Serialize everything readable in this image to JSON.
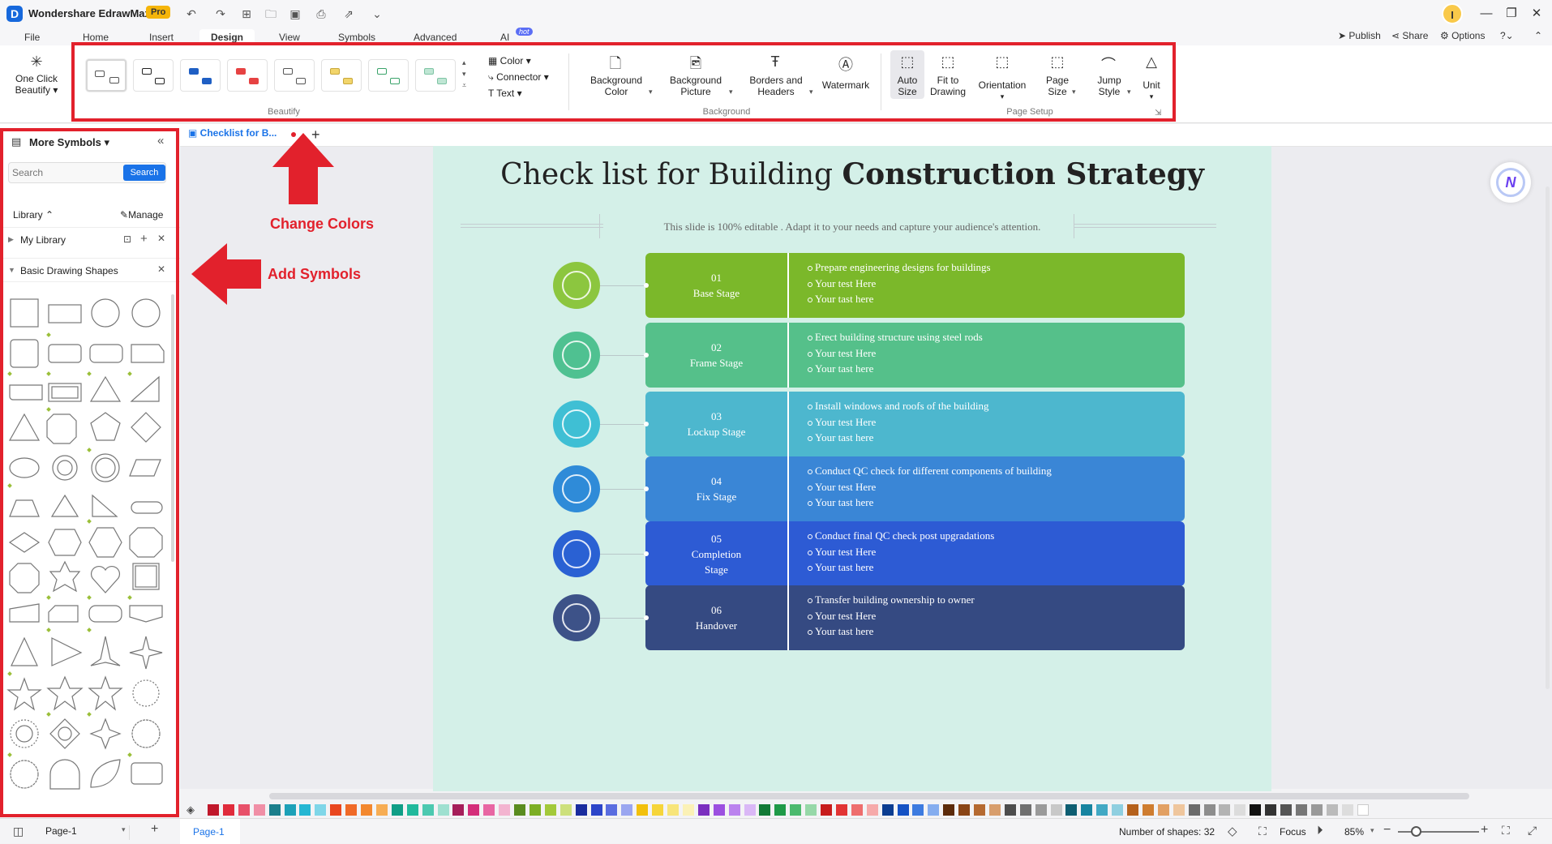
{
  "app": {
    "name": "Wondershare EdrawMax",
    "badge": "Pro",
    "user_initial": "I"
  },
  "menu": {
    "tabs": [
      "File",
      "Home",
      "Insert",
      "Design",
      "View",
      "Symbols",
      "Advanced",
      "AI"
    ],
    "active": "Design",
    "ai_badge": "hot",
    "right": {
      "publish": "Publish",
      "share": "Share",
      "options": "Options"
    }
  },
  "ribbon": {
    "one_click": {
      "line1": "One Click",
      "line2": "Beautify"
    },
    "beautify_label": "Beautify",
    "color": "Color",
    "connector": "Connector",
    "text": "Text",
    "background_label": "Background",
    "bg_color": {
      "line1": "Background",
      "line2": "Color"
    },
    "bg_picture": {
      "line1": "Background",
      "line2": "Picture"
    },
    "borders": {
      "line1": "Borders and",
      "line2": "Headers"
    },
    "watermark": "Watermark",
    "auto_size": {
      "line1": "Auto",
      "line2": "Size"
    },
    "fit": {
      "line1": "Fit to",
      "line2": "Drawing"
    },
    "orientation": "Orientation",
    "page_size": {
      "line1": "Page",
      "line2": "Size"
    },
    "jump": {
      "line1": "Jump",
      "line2": "Style"
    },
    "unit": "Unit",
    "page_setup_label": "Page Setup"
  },
  "left_panel": {
    "title": "More Symbols",
    "search_placeholder": "Search",
    "search_button": "Search",
    "library": "Library",
    "manage": "Manage",
    "my_library": "My Library",
    "basic_shapes": "Basic Drawing Shapes"
  },
  "doc_tab": "Checklist for B...",
  "annotations": {
    "change_colors": "Change Colors",
    "add_symbols": "Add Symbols"
  },
  "slide": {
    "title_normal": "Check list for Building ",
    "title_bold": "Construction Strategy",
    "subtitle": "This slide is 100% editable . Adapt it to your needs and capture your audience's attention.",
    "stages": [
      {
        "num": "01",
        "name": "Base Stage",
        "color": "#7bb82a",
        "circle": "#8cc63f",
        "items": [
          "Prepare engineering designs for buildings",
          "Your test Here",
          "Your tast here"
        ]
      },
      {
        "num": "02",
        "name": "Frame Stage",
        "color": "#55c08a",
        "circle": "#4fc191",
        "items": [
          "Erect building structure using steel rods",
          "Your test Here",
          "Your tast here"
        ]
      },
      {
        "num": "03",
        "name": "Lockup Stage",
        "color": "#4db7ce",
        "circle": "#3fbfd4",
        "items": [
          "Install windows and roofs of the building",
          "Your test Here",
          "Your tast here"
        ]
      },
      {
        "num": "04",
        "name": "Fix Stage",
        "color": "#3a86d6",
        "circle": "#2f8bd8",
        "items": [
          "Conduct QC check for different components of building",
          "Your test Here",
          "Your tast here"
        ]
      },
      {
        "num": "05",
        "name": "Completion Stage",
        "color": "#2d5bd4",
        "circle": "#2a61d3",
        "items": [
          "Conduct final QC check post upgradations",
          "Your test Here",
          "Your tast here"
        ]
      },
      {
        "num": "06",
        "name": "Handover",
        "color": "#354a82",
        "circle": "#3d5288",
        "items": [
          "Transfer building ownership to owner",
          "Your test Here",
          "Your tast here"
        ]
      }
    ]
  },
  "status": {
    "page_selector": "Page-1",
    "page_tab": "Page-1",
    "shapes": "Number of shapes: 32",
    "focus": "Focus",
    "zoom": "85%"
  }
}
